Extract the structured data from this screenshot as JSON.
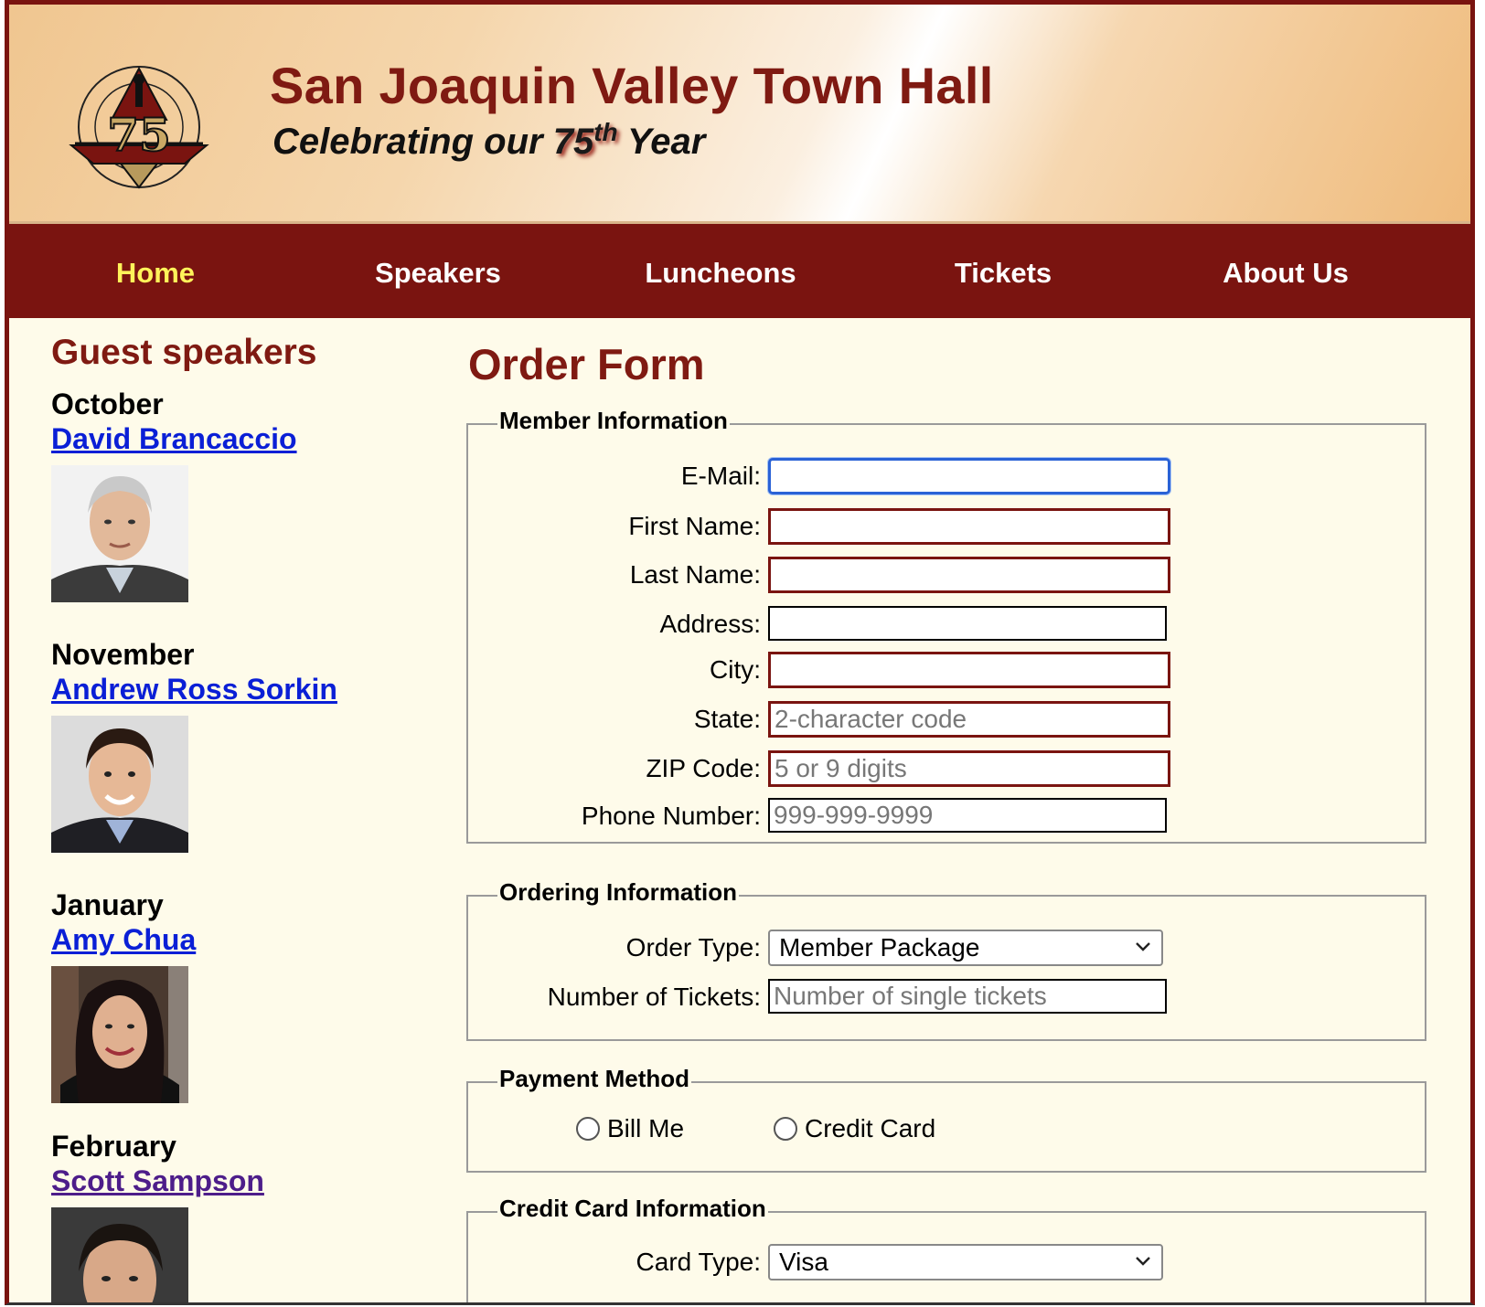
{
  "header": {
    "title": "San Joaquin Valley Town Hall",
    "tagline_prefix": "Celebrating our ",
    "tagline_number": "75",
    "tagline_sup": "th",
    "tagline_suffix": " Year",
    "logo_text": "75"
  },
  "nav": {
    "items": [
      {
        "label": "Home",
        "active": true
      },
      {
        "label": "Speakers"
      },
      {
        "label": "Luncheons"
      },
      {
        "label": "Tickets"
      },
      {
        "label": "About Us"
      }
    ]
  },
  "sidebar": {
    "heading": "Guest speakers",
    "speakers": [
      {
        "month": "October",
        "name": "David Brancaccio"
      },
      {
        "month": "November",
        "name": "Andrew Ross Sorkin"
      },
      {
        "month": "January",
        "name": "Amy Chua"
      },
      {
        "month": "February",
        "name": "Scott Sampson",
        "visited": true
      }
    ]
  },
  "form": {
    "title": "Order Form",
    "member": {
      "legend": "Member Information",
      "fields": [
        {
          "label": "E-Mail:",
          "value": "",
          "placeholder": ""
        },
        {
          "label": "First Name:",
          "value": "",
          "placeholder": ""
        },
        {
          "label": "Last Name:",
          "value": "",
          "placeholder": ""
        },
        {
          "label": "Address:",
          "value": "",
          "placeholder": ""
        },
        {
          "label": "City:",
          "value": "",
          "placeholder": ""
        },
        {
          "label": "State:",
          "value": "",
          "placeholder": "2-character code"
        },
        {
          "label": "ZIP Code:",
          "value": "",
          "placeholder": "5 or 9 digits"
        },
        {
          "label": "Phone Number:",
          "value": "",
          "placeholder": "999-999-9999"
        }
      ]
    },
    "ordering": {
      "legend": "Ordering Information",
      "order_type_label": "Order Type:",
      "order_type_value": "Member Package",
      "tickets_label": "Number of Tickets:",
      "tickets_placeholder": "Number of single tickets"
    },
    "payment": {
      "legend": "Payment Method",
      "options": [
        "Bill Me",
        "Credit Card"
      ]
    },
    "credit": {
      "legend": "Credit Card Information",
      "card_type_label": "Card Type:",
      "card_type_value": "Visa"
    }
  },
  "colors": {
    "brand": "#7a1410",
    "nav_active": "#fff35a",
    "link": "#0a1fd6",
    "link_visited": "#4d1d8a",
    "background": "#fefbea"
  }
}
